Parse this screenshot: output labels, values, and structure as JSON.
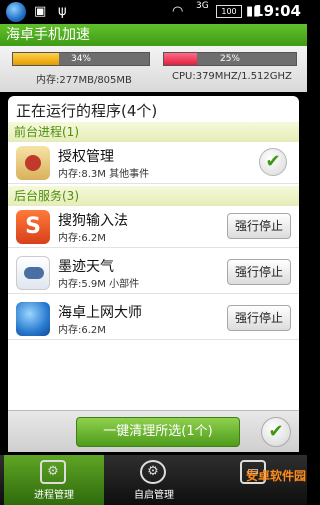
{
  "status_bar": {
    "time": "19:04",
    "battery": "100",
    "network": "3G",
    "icons": [
      "globe-icon",
      "android-icon",
      "usb-icon",
      "wifi-icon",
      "signal-icon"
    ]
  },
  "app_title": "海卓手机加速",
  "stats": {
    "memory_percent_label": "34%",
    "memory_fraction": 0.34,
    "memory_text": "内存:277MB/805MB",
    "cpu_percent_label": "25%",
    "cpu_fraction": 0.25,
    "cpu_text": "CPU:379MHZ/1.512GHZ"
  },
  "card": {
    "title": "正在运行的程序(4个)",
    "foreground_header": "前台进程(1)",
    "background_header": "后台服务(3)"
  },
  "foreground_items": [
    {
      "name": "授权管理",
      "info": "内存:8.3M 其他事件",
      "icon": "auth-icon"
    }
  ],
  "background_items": [
    {
      "name": "搜狗输入法",
      "info": "内存:6.2M",
      "button": "强行停止",
      "icon": "sogou-icon"
    },
    {
      "name": "墨迹天气",
      "info": "内存:5.9M 小部件",
      "button": "强行停止",
      "icon": "moji-weather-icon"
    },
    {
      "name": "海卓上网大师",
      "info": "内存:6.2M",
      "button": "强行停止",
      "icon": "haizhuo-browser-icon"
    }
  ],
  "action": {
    "clean_label": "一键清理所选(1个)"
  },
  "tabs": [
    {
      "label": "进程管理",
      "icon": "process-icon"
    },
    {
      "label": "自启管理",
      "icon": "gear-icon"
    },
    {
      "label": "",
      "icon": "monitor-icon"
    }
  ],
  "watermark": "安卓软件园",
  "colors": {
    "accent_green": "#4f9b1c",
    "memory_bar": "#e79b00",
    "cpu_bar": "#e0203f"
  }
}
